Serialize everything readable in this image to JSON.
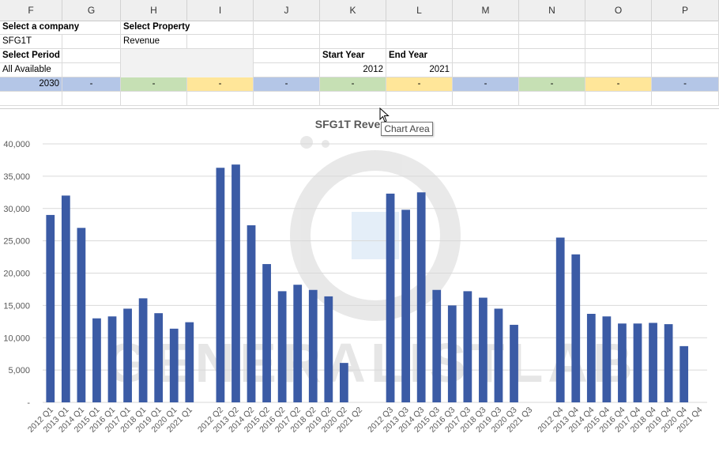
{
  "columns": [
    "F",
    "G",
    "H",
    "I",
    "J",
    "K",
    "L",
    "M",
    "N",
    "O",
    "P"
  ],
  "cells": {
    "company_label": "Select a company",
    "company_value": "SFG1T",
    "property_label": "Select Property",
    "property_value": "Revenue",
    "period_label": "Select Period",
    "period_value": "All Available",
    "start_label": "Start Year",
    "start_value": "2012",
    "end_label": "End Year",
    "end_value": "2021",
    "row5_year": "2030",
    "row5_dash": "-"
  },
  "colors": {
    "blue_band": "#b4c6e7",
    "green_band": "#c6e0b4",
    "yellow_band": "#ffe699",
    "bar": "#3b5ba5",
    "gray_fill": "#f2f2f2"
  },
  "tooltip": "Chart Area",
  "watermark": "GENERALISTLAB",
  "chart_data": {
    "type": "bar",
    "title": "SFG1T Reve",
    "ylim": [
      0,
      40000
    ],
    "yticks": [
      "-",
      "5,000",
      "10,000",
      "15,000",
      "20,000",
      "25,000",
      "30,000",
      "35,000",
      "40,000"
    ],
    "gridlines": true,
    "categories": [
      "2012 Q1",
      "2013 Q1",
      "2014 Q1",
      "2015 Q1",
      "2016 Q1",
      "2017 Q1",
      "2018 Q1",
      "2019 Q1",
      "2020 Q1",
      "2021 Q1",
      "",
      "2012 Q2",
      "2013 Q2",
      "2014 Q2",
      "2015 Q2",
      "2016 Q2",
      "2017 Q2",
      "2018 Q2",
      "2019 Q2",
      "2020 Q2",
      "2021 Q2",
      "",
      "2012 Q3",
      "2013 Q3",
      "2014 Q3",
      "2015 Q3",
      "2016 Q3",
      "2017 Q3",
      "2018 Q3",
      "2019 Q3",
      "2020 Q3",
      "2021 Q3",
      "",
      "2012 Q4",
      "2013 Q4",
      "2014 Q4",
      "2015 Q4",
      "2016 Q4",
      "2017 Q4",
      "2018 Q4",
      "2019 Q4",
      "2020 Q4",
      "2021 Q4"
    ],
    "values": [
      29000,
      32000,
      27000,
      13000,
      13300,
      14500,
      16100,
      13800,
      11400,
      12400,
      null,
      36300,
      36800,
      27400,
      21400,
      17200,
      18200,
      17400,
      16400,
      6100,
      null,
      null,
      32300,
      29800,
      32500,
      17400,
      15000,
      17200,
      16200,
      14500,
      12000,
      null,
      null,
      25500,
      22900,
      13700,
      13300,
      12200,
      12200,
      12300,
      12100,
      8700
    ]
  }
}
